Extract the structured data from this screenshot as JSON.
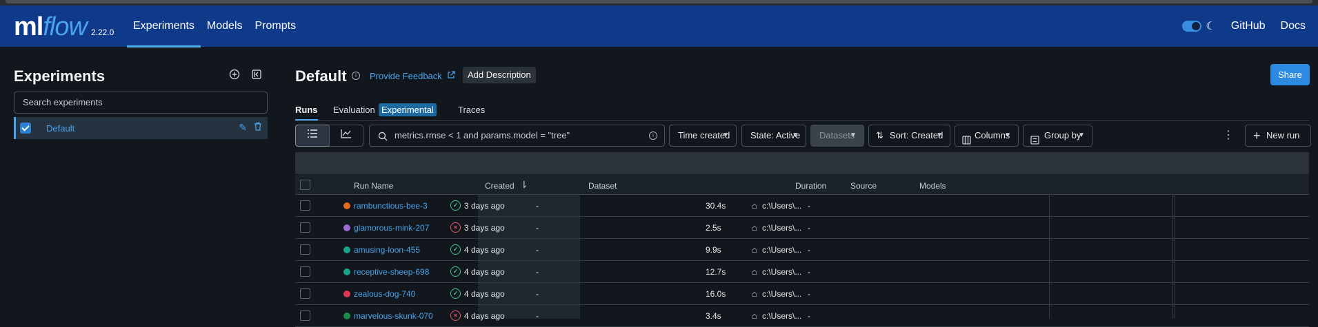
{
  "app": {
    "logo_ml": "ml",
    "logo_flow": "flow",
    "version": "2.22.0",
    "nav": [
      {
        "label": "Experiments",
        "active": true
      },
      {
        "label": "Models",
        "active": false
      },
      {
        "label": "Prompts",
        "active": false
      }
    ],
    "github": "GitHub",
    "docs": "Docs",
    "accent": "#4aa3ec",
    "header_bg": "#0f3a8a"
  },
  "sidebar": {
    "title": "Experiments",
    "search_placeholder": "Search experiments",
    "experiments": [
      {
        "name": "Default",
        "checked": true
      }
    ]
  },
  "main": {
    "title": "Default",
    "feedback": "Provide Feedback",
    "add_description": "Add Description",
    "share": "Share",
    "tabs": [
      {
        "label": "Runs",
        "active": true
      },
      {
        "label": "Evaluation",
        "active": false
      },
      {
        "label": "Traces",
        "active": false
      }
    ],
    "experimental_tag": "Experimental",
    "search_value": "metrics.rmse < 1 and params.model = \"tree\"",
    "filters": {
      "time": "Time created",
      "state": "State: Active",
      "datasets": "Datasets",
      "sort": "Sort: Created",
      "columns": "Columns",
      "group": "Group by"
    },
    "new_run": "New run"
  },
  "table": {
    "headers": {
      "run_name": "Run Name",
      "created": "Created",
      "dataset": "Dataset",
      "duration": "Duration",
      "source": "Source",
      "models": "Models"
    },
    "rows": [
      {
        "name": "rambunctious-bee-3",
        "color": "#e06a1e",
        "status": "ok",
        "created": "3 days ago",
        "dataset": "-",
        "duration": "30.4s",
        "source": "c:\\Users\\...",
        "models": "-"
      },
      {
        "name": "glamorous-mink-207",
        "color": "#9b6ad6",
        "status": "fail",
        "created": "3 days ago",
        "dataset": "-",
        "duration": "2.5s",
        "source": "c:\\Users\\...",
        "models": "-"
      },
      {
        "name": "amusing-loon-455",
        "color": "#17a08a",
        "status": "ok",
        "created": "4 days ago",
        "dataset": "-",
        "duration": "9.9s",
        "source": "c:\\Users\\...",
        "models": "-"
      },
      {
        "name": "receptive-sheep-698",
        "color": "#17a08a",
        "status": "ok",
        "created": "4 days ago",
        "dataset": "-",
        "duration": "12.7s",
        "source": "c:\\Users\\...",
        "models": "-"
      },
      {
        "name": "zealous-dog-740",
        "color": "#e0354f",
        "status": "ok",
        "created": "4 days ago",
        "dataset": "-",
        "duration": "16.0s",
        "source": "c:\\Users\\...",
        "models": "-"
      },
      {
        "name": "marvelous-skunk-070",
        "color": "#1a8a4a",
        "status": "fail",
        "created": "4 days ago",
        "dataset": "-",
        "duration": "3.4s",
        "source": "c:\\Users\\...",
        "models": "-"
      }
    ]
  }
}
